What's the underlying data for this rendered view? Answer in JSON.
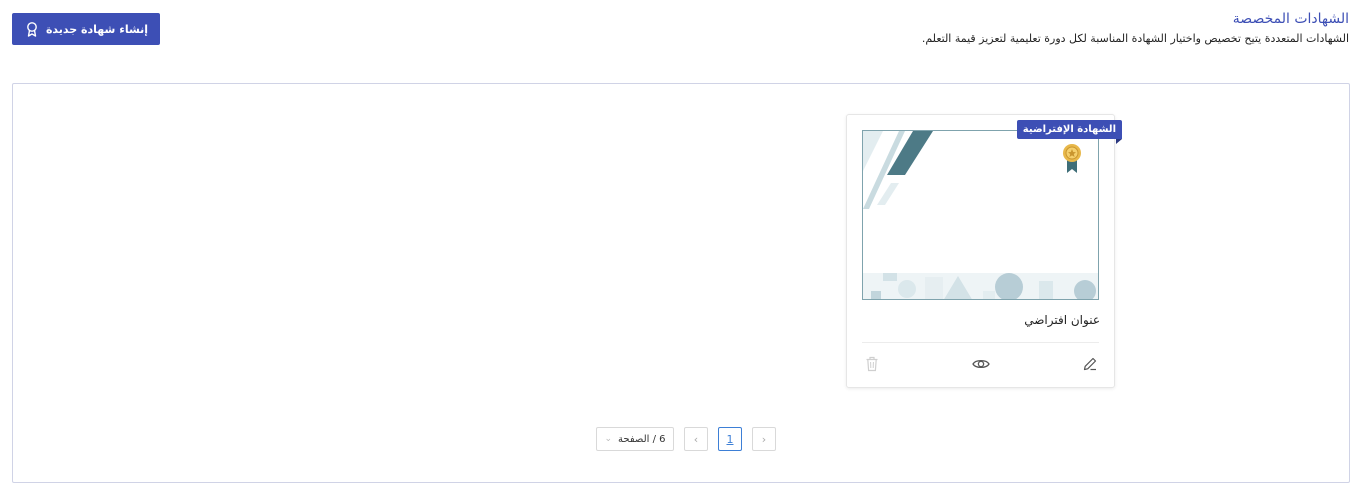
{
  "header": {
    "title": "الشهادات المخصصة",
    "description": "الشهادات المتعددة يتيح تخصيص واختيار الشهادة المناسبة لكل دورة تعليمية لتعزيز قيمة التعلم.",
    "create_button_label": "إنشاء شهادة جديدة",
    "create_button_icon": "award-ribbon-icon"
  },
  "certificates": [
    {
      "title": "عنوان افتراضي",
      "badge": "الشهادة الإفتراضية",
      "actions": [
        "edit-icon",
        "eye-icon",
        "trash-icon"
      ]
    }
  ],
  "pagination": {
    "page_size_label": "6 / الصفحة",
    "current_page": "1",
    "prev_symbol": "‹",
    "next_symbol": "›"
  },
  "colors": {
    "accent": "#3d4fb5",
    "thumb_teal": "#4d7a86",
    "thumb_light": "#dbe8ec",
    "medal_gold": "#e8b84a"
  }
}
